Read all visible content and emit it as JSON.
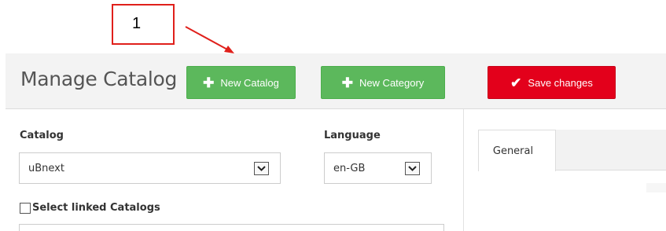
{
  "annotation": {
    "number": "1",
    "color": "#e0201b"
  },
  "header": {
    "title": "Manage Catalog",
    "buttons": {
      "new_catalog": {
        "label": "New Catalog",
        "icon": "plus-icon"
      },
      "new_category": {
        "label": "New Category",
        "icon": "plus-icon"
      },
      "save_changes": {
        "label": "Save changes",
        "icon": "checkmark-icon"
      }
    }
  },
  "form": {
    "catalog": {
      "label": "Catalog",
      "value": "uBnext"
    },
    "language": {
      "label": "Language",
      "value": "en-GB"
    },
    "linked_catalogs": {
      "label": "Select linked Catalogs",
      "checked": false
    }
  },
  "tabs": [
    {
      "label": "General",
      "active": true
    }
  ],
  "colors": {
    "green": "#5cb85c",
    "red": "#e3001b",
    "header_bg": "#f3f3f3"
  }
}
